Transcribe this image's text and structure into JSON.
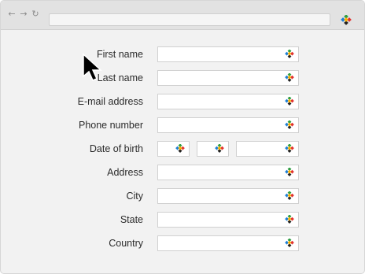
{
  "browser": {
    "back_icon": "back-arrow-icon",
    "forward_icon": "forward-arrow-icon",
    "reload_icon": "reload-icon",
    "address_value": "",
    "extension_icon": "password-manager-icon"
  },
  "form": {
    "fields": [
      {
        "label": "First name",
        "value": ""
      },
      {
        "label": "Last name",
        "value": ""
      },
      {
        "label": "E-mail address",
        "value": ""
      },
      {
        "label": "Phone number",
        "value": ""
      },
      {
        "label": "Date of birth",
        "value": ""
      },
      {
        "label": "Address",
        "value": ""
      },
      {
        "label": "City",
        "value": ""
      },
      {
        "label": "State",
        "value": ""
      },
      {
        "label": "Country",
        "value": ""
      }
    ],
    "autofill_icon": "password-manager-icon"
  },
  "colors": {
    "window_bg": "#f2f2f2",
    "toolbar_bg": "#e2e2e2",
    "field_border": "#d0d0d0",
    "label_text": "#2b2b2b"
  }
}
